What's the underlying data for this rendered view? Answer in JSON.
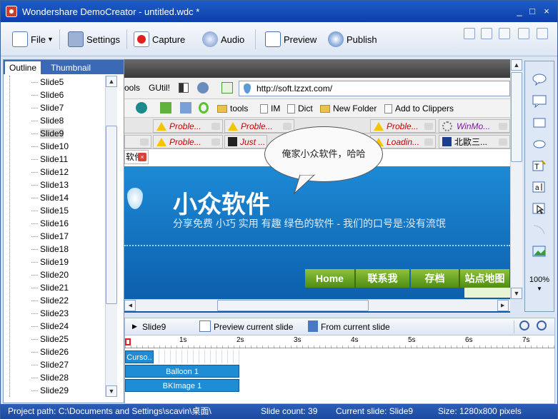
{
  "window": {
    "title": "Wondershare DemoCreator - untitled.wdc *",
    "controls": [
      "_",
      "□",
      "×"
    ]
  },
  "toolbar": {
    "file": "File",
    "settings": "Settings",
    "capture": "Capture",
    "audio": "Audio",
    "preview": "Preview",
    "publish": "Publish",
    "accent_color": "#1e5cc8"
  },
  "left_panel": {
    "tabs": [
      "Outline",
      "Thumbnail"
    ],
    "slides": [
      "Slide5",
      "Slide6",
      "Slide7",
      "Slide8",
      "Slide9",
      "Slide10",
      "Slide11",
      "Slide12",
      "Slide13",
      "Slide14",
      "Slide15",
      "Slide16",
      "Slide17",
      "Slide18",
      "Slide19",
      "Slide20",
      "Slide21",
      "Slide22",
      "Slide23",
      "Slide24",
      "Slide25",
      "Slide26",
      "Slide27",
      "Slide28",
      "Slide29"
    ],
    "selected": "Slide9"
  },
  "canvas": {
    "toolbar_items": {
      "a": "ools",
      "b": "GUtil!"
    },
    "address": "http://soft.lzzxt.com/",
    "bookmarks": [
      "tools",
      "IM",
      "Dict",
      "New Folder",
      "Add to Clippers"
    ],
    "tabs_row1": [
      "Proble...",
      "Proble...",
      "Proble...",
      "WinMo..."
    ],
    "tabs_row2": [
      "Proble...",
      "Just ...",
      "Loadin...",
      "北歐三..."
    ],
    "tab_active": "软件",
    "site_title": "小众软件",
    "site_subtitle": "分享免费 小巧 实用 有趣 绿色的软件 - 我们的口号是:没有流氓",
    "nav": [
      "Home",
      "联系我",
      "存档",
      "站点地图"
    ],
    "balloon_text": "俺家小众软件，哈哈"
  },
  "right_tools": {
    "zoom": "100%"
  },
  "timeline": {
    "current_slide": "Slide9",
    "preview_current": "Preview current slide",
    "from_current": "From current slide",
    "ruler_labels": [
      "1s",
      "2s",
      "3s",
      "4s",
      "5s",
      "6s",
      "7s"
    ],
    "tracks": [
      "Curso..",
      "Balloon 1",
      "BKImage 1"
    ]
  },
  "status": {
    "project_path": "Project path: C:\\Documents and Settings\\scavin\\桌面\\",
    "slide_count": "Slide count: 39",
    "current_slide": "Current slide: Slide9",
    "size": "Size: 1280x800 pixels"
  }
}
